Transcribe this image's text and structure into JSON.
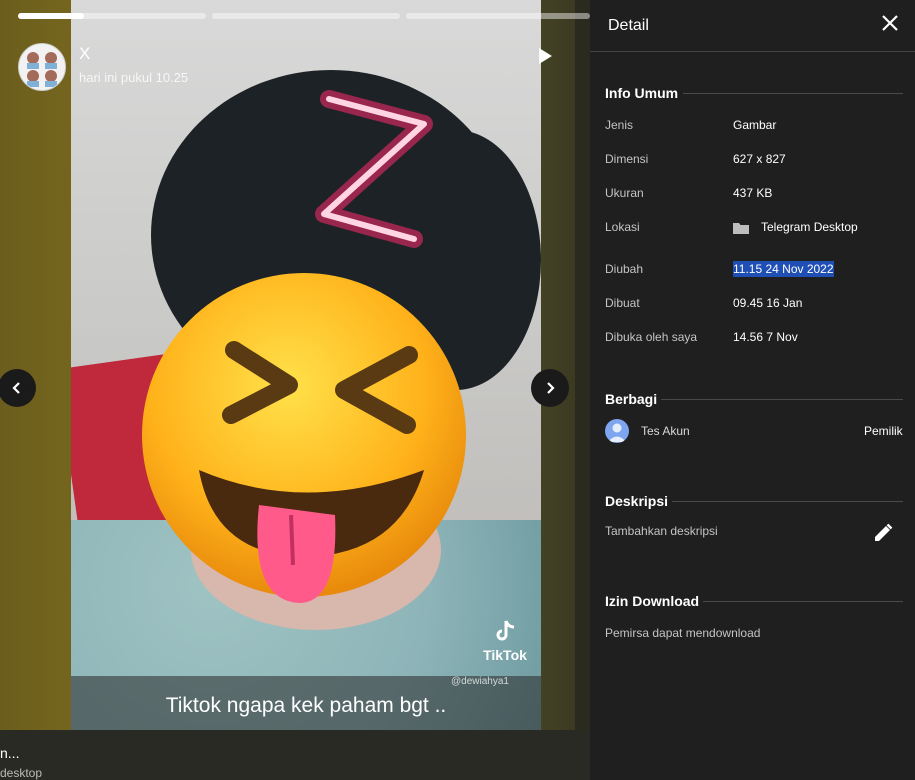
{
  "story": {
    "author": "X",
    "posted_time": "hari ini pukul 10.25",
    "caption": "Tiktok ngapa kek paham bgt ..",
    "watermark": "TikTok",
    "watermark_user": "@dewiahya1",
    "progress_segments": [
      0.35,
      0,
      0
    ]
  },
  "side_captions": {
    "line1": "n...",
    "line2": "desktop"
  },
  "details": {
    "title": "Detail",
    "general": {
      "heading": "Info Umum",
      "rows": [
        {
          "label": "Jenis",
          "value": "Gambar"
        },
        {
          "label": "Dimensi",
          "value": "627 x 827"
        },
        {
          "label": "Ukuran",
          "value": "437 KB"
        },
        {
          "label": "Lokasi",
          "value": "Telegram Desktop"
        },
        {
          "label": "Diubah",
          "value": "11.15 24 Nov 2022"
        },
        {
          "label": "Dibuat",
          "value": "09.45 16 Jan"
        },
        {
          "label": "Dibuka oleh saya",
          "value": "14.56 7 Nov"
        }
      ]
    },
    "sharing": {
      "heading": "Berbagi",
      "user": "Tes Akun",
      "role": "Pemilik"
    },
    "description": {
      "heading": "Deskripsi",
      "placeholder": "Tambahkan deskripsi"
    },
    "download": {
      "heading": "Izin Download",
      "text": "Pemirsa dapat mendownload"
    }
  },
  "colors": {
    "selection": "#1f4fb5",
    "panel_bg": "#1f1f1f",
    "neon": "#ff2a6d"
  },
  "icons": [
    "play-icon",
    "close-icon",
    "chevron-left-icon",
    "chevron-right-icon",
    "folder-icon",
    "edit-icon",
    "tiktok-icon"
  ]
}
